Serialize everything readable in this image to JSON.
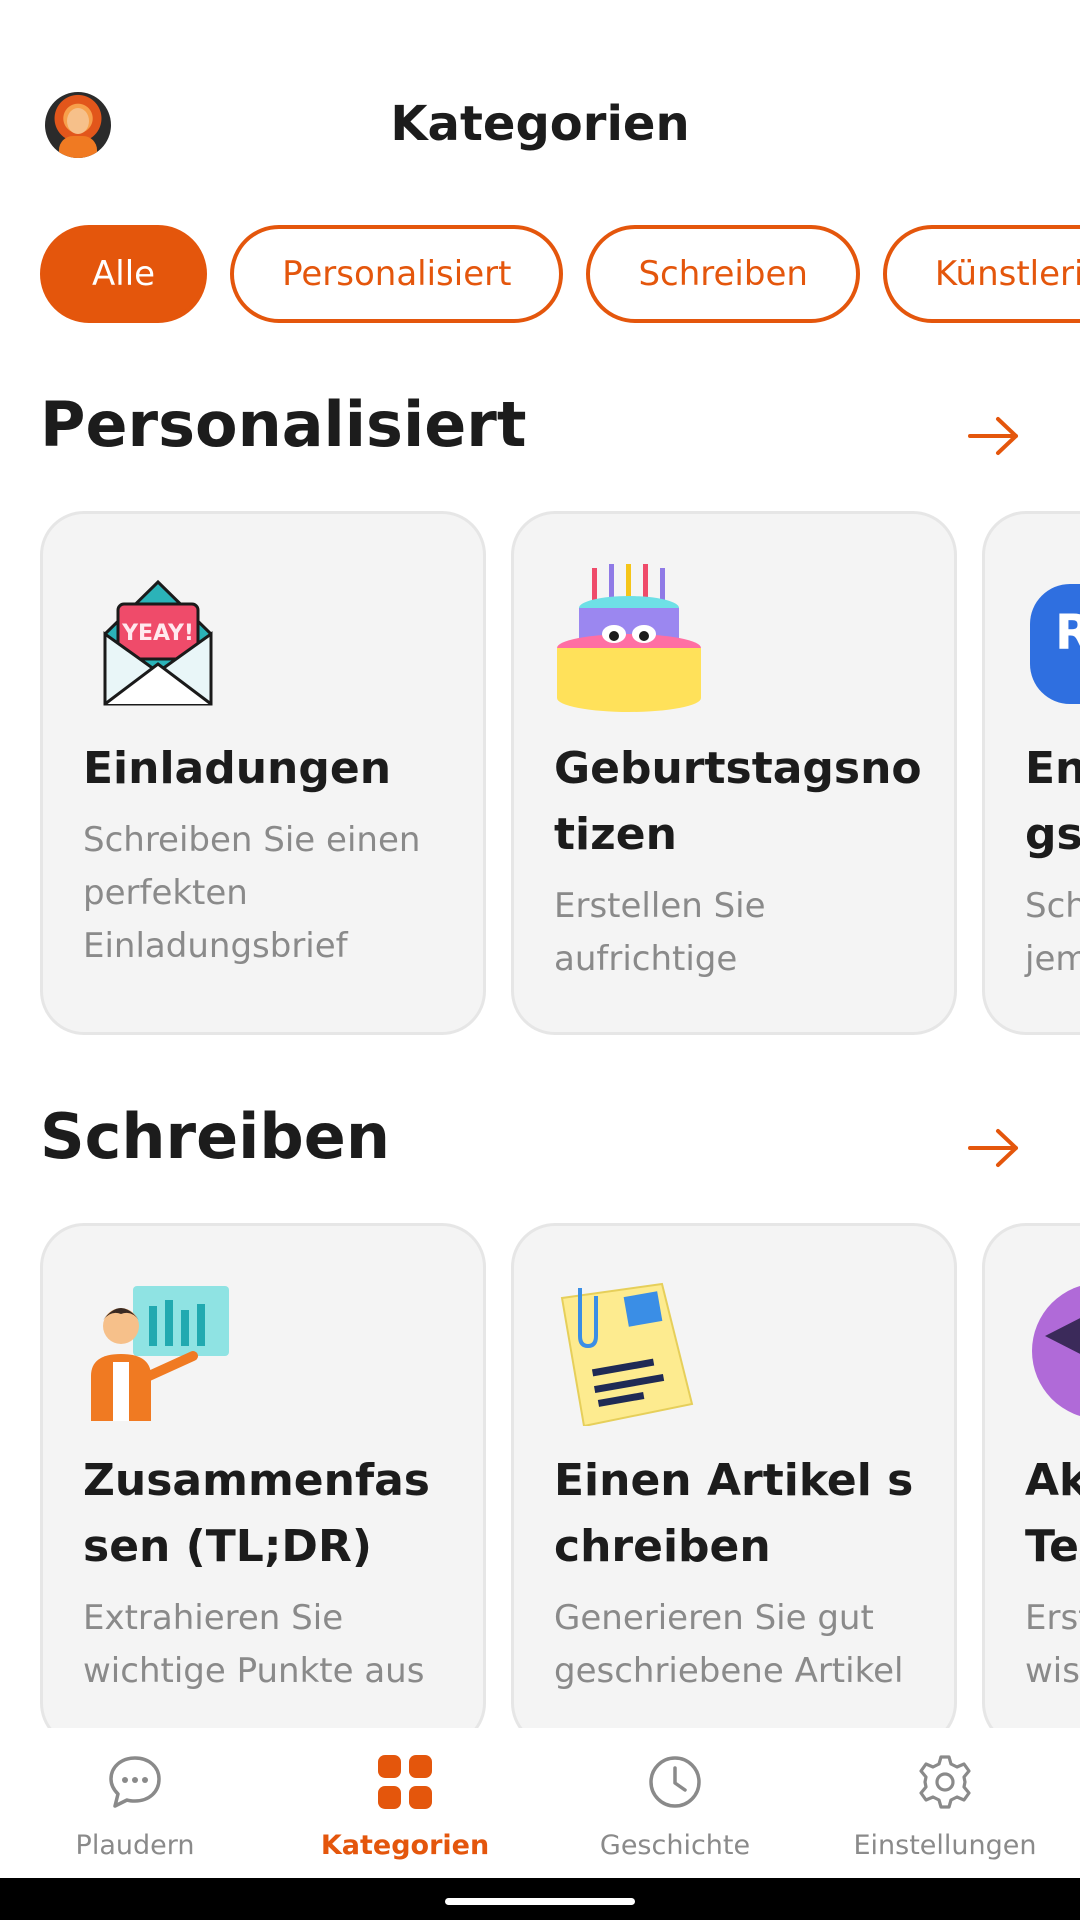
{
  "header": {
    "title": "Kategorien"
  },
  "chips": [
    {
      "label": "Alle",
      "active": true
    },
    {
      "label": "Personalisiert",
      "active": false
    },
    {
      "label": "Schreiben",
      "active": false
    },
    {
      "label": "Künstlerisch",
      "active": false
    }
  ],
  "sections": [
    {
      "title": "Personalisiert",
      "cards": [
        {
          "icon": "yeay-envelope-icon",
          "title": "Einladungen",
          "desc": "Schreiben Sie einen perfekten Einladungsbrief"
        },
        {
          "icon": "birthday-cake-icon",
          "title": "Geburtstagsnotizen",
          "desc": "Erstellen Sie aufrichtige"
        },
        {
          "icon": "sticker-icon",
          "title": "Entschuldigungsnotiz",
          "desc": "Schreiben Sie jemandem"
        }
      ]
    },
    {
      "title": "Schreiben",
      "cards": [
        {
          "icon": "presenter-chart-icon",
          "title": "Zusammenfassen (TL;DR)",
          "desc": "Extrahieren Sie wichtige Punkte aus"
        },
        {
          "icon": "sticky-note-icon",
          "title": "Einen Artikel schreiben",
          "desc": "Generieren Sie gut geschriebene Artikel"
        },
        {
          "icon": "academic-icon",
          "title": "Akademischer Text",
          "desc": "Erstellen Sie wissenschaftliche"
        }
      ]
    }
  ],
  "nav": [
    {
      "icon": "chat-bubble-icon",
      "label": "Plaudern",
      "active": false
    },
    {
      "icon": "grid-icon",
      "label": "Kategorien",
      "active": true
    },
    {
      "icon": "clock-icon",
      "label": "Geschichte",
      "active": false
    },
    {
      "icon": "gear-icon",
      "label": "Einstellungen",
      "active": false
    }
  ],
  "colors": {
    "accent": "#e4560c",
    "card_bg": "#f4f4f4",
    "muted_text": "#8a8a8a"
  }
}
